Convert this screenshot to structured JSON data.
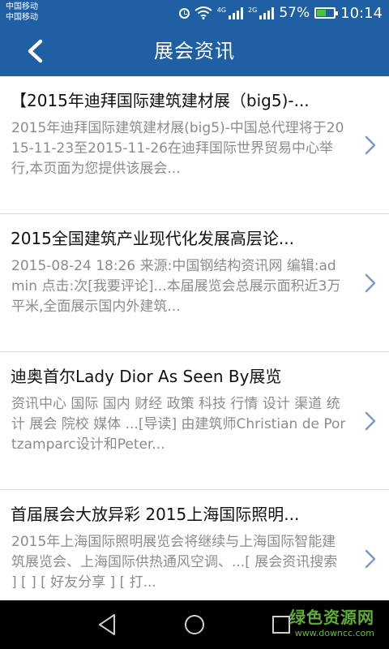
{
  "status_bar": {
    "carrier_1": "中国移动",
    "carrier_2": "中国移动",
    "network_1": "4G",
    "network_2": "2G",
    "battery_percent": "57%",
    "battery_level": 0.57,
    "time": "10:14",
    "icons": [
      "alarm-icon",
      "wifi-icon",
      "signal-icon",
      "battery-icon"
    ]
  },
  "header": {
    "title": "展会资讯",
    "back_icon": "chevron-left-icon"
  },
  "news": [
    {
      "title": "【2015年迪拜国际建筑建材展（big5)-...",
      "summary": "2015年迪拜国际建筑建材展(big5)-中国总代理将于2015-11-23至2015-11-26在迪拜国际世界贸易中心举行,本页面为您提供该展会..."
    },
    {
      "title": "2015全国建筑产业现代化发展高层论...",
      "summary": "2015-08-24 18:26 来源:中国钢结构资讯网 编辑:admin 点击:次[我要评论]...本届展览会总展示面积近3万平米,全面展示国内外建筑..."
    },
    {
      "title": "迪奥首尔Lady Dior As Seen By展览",
      "summary": "资讯中心 国际 国内 财经 政策 科技 行情 设计 渠道 统计 展会 院校 媒体 ...[导读] 由建筑师Christian de Portzamparc设计和Peter..."
    },
    {
      "title": "首届展会大放异彩 2015上海国际照明...",
      "summary": "2015年上海国际照明展览会将继续与上海国际智能建筑展览会、上海国际供热通风空调、...[ 展会资讯搜索 ] [ ] [ 好友分享 ] [ 打..."
    }
  ],
  "system_nav": {
    "icons": [
      "back-triangle-icon",
      "home-circle-icon",
      "recent-square-icon"
    ]
  },
  "watermark": {
    "name": "绿色资源网",
    "url": "www.downcc.com"
  },
  "colors": {
    "header_bg": "#1f5fa4",
    "title_text": "#111111",
    "summary_text": "#8c8c8c",
    "divider": "#d9d9d9",
    "chevron": "#7a9bc4",
    "watermark_green": "#5fae33"
  }
}
